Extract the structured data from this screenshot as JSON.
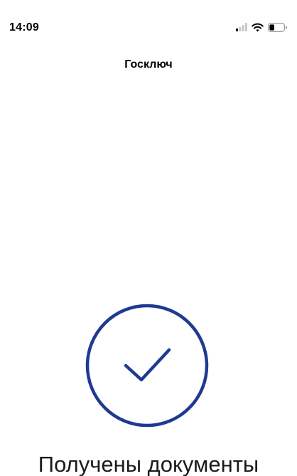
{
  "status_bar": {
    "time": "14:09",
    "icons": [
      "signal-icon",
      "wifi-icon",
      "battery-icon"
    ]
  },
  "header": {
    "title": "Госключ"
  },
  "main": {
    "status_icon": "checkmark-circle-icon",
    "message": "Получены документы"
  },
  "colors": {
    "accent": "#1f3a93",
    "background": "#ffffff",
    "text": "#000000"
  }
}
